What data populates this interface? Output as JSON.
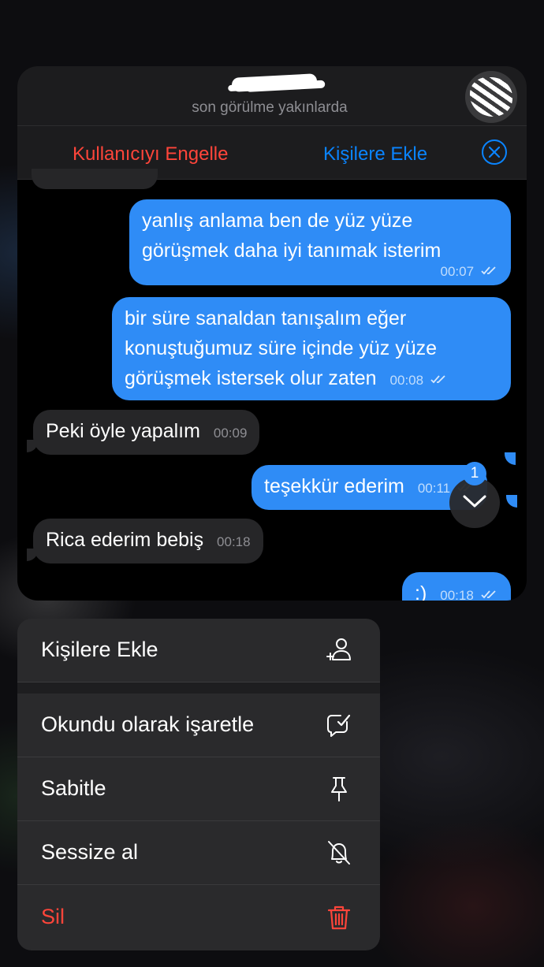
{
  "header": {
    "status": "son görülme yakınlarda"
  },
  "actions": {
    "block_label": "Kullanıcıyı Engelle",
    "add_contact_label": "Kişilere Ekle"
  },
  "messages": [
    {
      "dir": "out",
      "lines": [
        "yanlış anlama ben de yüz yüze",
        "görüşmek daha iyi tanımak isterim"
      ],
      "time": "00:07"
    },
    {
      "dir": "out",
      "lines": [
        "bir süre sanaldan tanışalım eğer",
        "konuştuğumuz süre içinde yüz yüze",
        "görüşmek istersek olur zaten"
      ],
      "time": "00:08"
    },
    {
      "dir": "in",
      "text": "Peki öyle yapalım",
      "time": "00:09"
    },
    {
      "dir": "out",
      "text": "teşekkür ederim",
      "time": "00:11"
    },
    {
      "dir": "in",
      "text": "Rica ederim bebiş",
      "time": "00:18"
    },
    {
      "dir": "out",
      "text": ":)",
      "time": "00:18"
    }
  ],
  "scroll": {
    "unread_count": "1"
  },
  "menu": {
    "items": [
      {
        "label": "Kişilere Ekle",
        "icon": "add-contact-icon"
      },
      {
        "label": "Okundu olarak işaretle",
        "icon": "mark-read-icon"
      },
      {
        "label": "Sabitle",
        "icon": "pin-icon"
      },
      {
        "label": "Sessize al",
        "icon": "mute-bell-icon"
      },
      {
        "label": "Sil",
        "icon": "trash-icon"
      }
    ]
  },
  "colors": {
    "accent": "#0a84ff",
    "destructive": "#ff453a",
    "outgoing_bubble": "#2f8cf6",
    "incoming_bubble": "#262628"
  }
}
